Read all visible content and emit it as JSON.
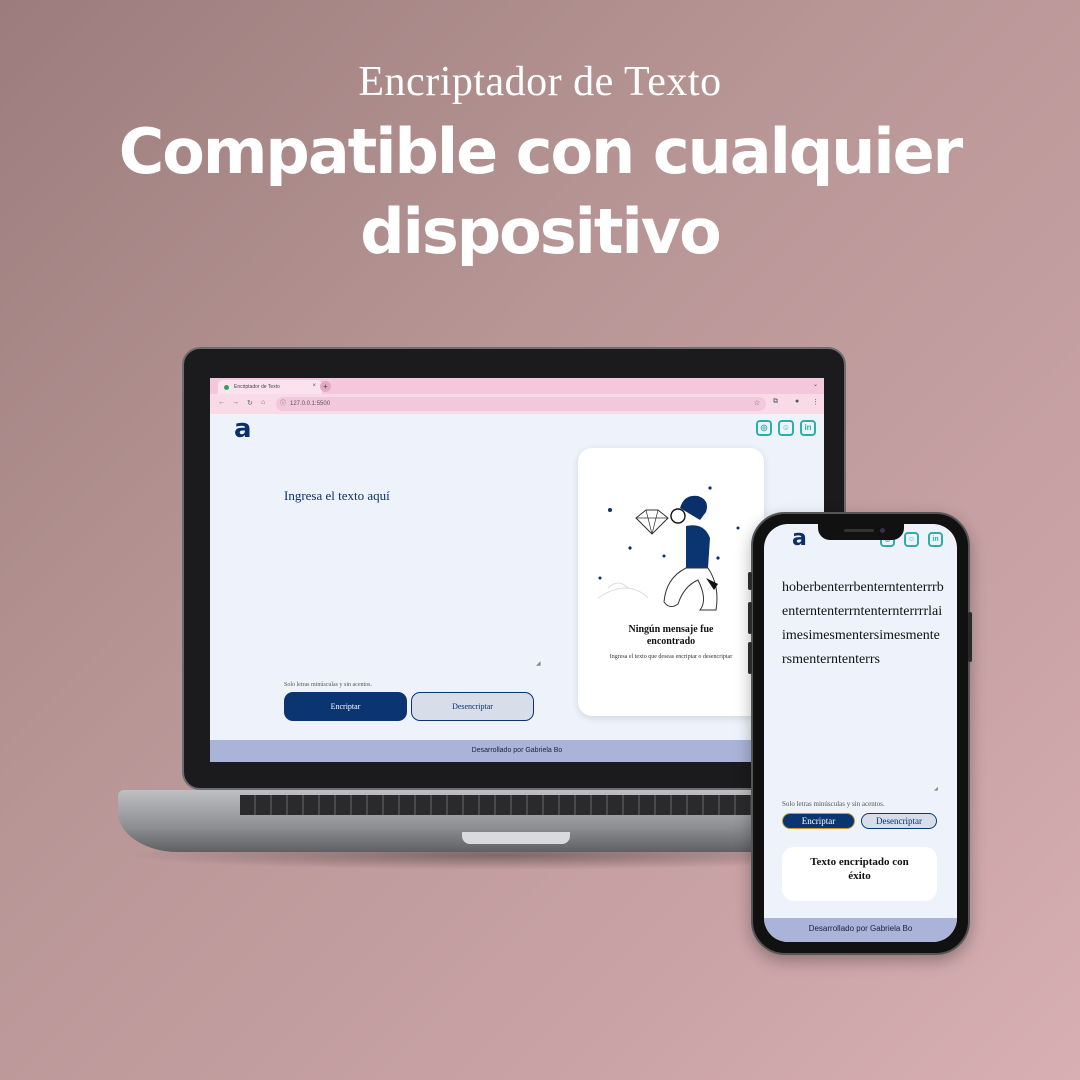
{
  "heading": {
    "subtitle": "Encriptador de Texto",
    "title": "Compatible con cualquier dispositivo"
  },
  "browser": {
    "tab_title": "Encriptador de Texto",
    "tab_close": "×",
    "new_tab": "+",
    "url": "127.0.0.1:5500"
  },
  "app": {
    "logo": "a",
    "social": [
      {
        "icon": "instagram-icon"
      },
      {
        "icon": "github-icon"
      },
      {
        "icon": "linkedin-icon",
        "label": "in"
      }
    ],
    "input_placeholder": "Ingresa el texto aquí",
    "hint": "Solo letras minúsculas y sin acentos.",
    "encrypt_label": "Encriptar",
    "decrypt_label": "Desencriptar",
    "card_title": "Ningún mensaje fue encontrado",
    "card_subtitle": "Ingresa el texto que deseas encriptar o desencriptar",
    "footer": "Desarrollado por Gabriela Bo"
  },
  "phone": {
    "input_text": "hoberbenterrbenterntenterrrbenterntenterrntenternterrrrlaiimesimesmentersimesmentersmenterntenterrs",
    "hint": "Solo letras minúsculas y sin acentos.",
    "encrypt_label": "Encriptar",
    "decrypt_label": "Desencriptar",
    "card_title": "Texto encriptado con éxito",
    "footer": "Desarrollado por Gabriela Bo"
  },
  "colors": {
    "brand_navy": "#0b3570",
    "accent_teal": "#2ab0a7",
    "footer_bg": "#a9b4d8",
    "browser_pink": "#f4c7dc"
  }
}
